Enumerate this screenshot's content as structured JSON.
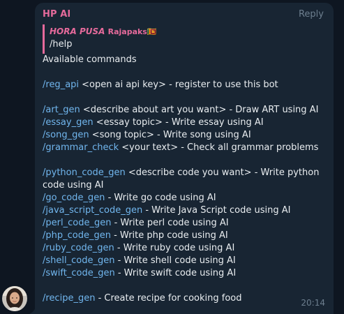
{
  "message": {
    "sender": "HP AI",
    "reply_label": "Reply",
    "time": "20:14",
    "quote": {
      "author": "HORA PUSA",
      "author_suffix": "Rajapaks🇱🇰",
      "text": "/help"
    },
    "heading": "Available commands",
    "commands": [
      {
        "cmd": "/reg_api",
        "desc": " <open ai api key> - register to use this bot"
      },
      {
        "cmd": "/art_gen",
        "desc": " <describe about art you want> - Draw ART using AI"
      },
      {
        "cmd": "/essay_gen",
        "desc": " <essay topic> - Write essay using AI"
      },
      {
        "cmd": "/song_gen",
        "desc": " <song topic> - Write song using AI"
      },
      {
        "cmd": "/grammar_check",
        "desc": " <your text> - Check all grammar problems"
      },
      {
        "cmd": "/python_code_gen",
        "desc": " <describe code you want> - Write python code using AI"
      },
      {
        "cmd": "/go_code_gen",
        "desc": " - Write go code using AI"
      },
      {
        "cmd": "/java_script_code_gen",
        "desc": " - Write Java Script code using AI"
      },
      {
        "cmd": "/perl_code_gen",
        "desc": " - Write perl code using AI"
      },
      {
        "cmd": "/php_code_gen",
        "desc": " - Write php code using AI"
      },
      {
        "cmd": "/ruby_code_gen",
        "desc": " - Write ruby code using AI"
      },
      {
        "cmd": "/shell_code_gen",
        "desc": " - Write shell code using AI"
      },
      {
        "cmd": "/swift_code_gen",
        "desc": " - Write swift code using AI"
      },
      {
        "cmd": "/recipe_gen",
        "desc": " - Create recipe for cooking food"
      }
    ]
  },
  "colors": {
    "background": "#0e1621",
    "bubble": "#182533",
    "accent": "#e56a9b",
    "link": "#71b6ee",
    "text": "#e9edf0",
    "muted": "#6d7f8f"
  },
  "avatar_icon": "user-avatar-photo"
}
